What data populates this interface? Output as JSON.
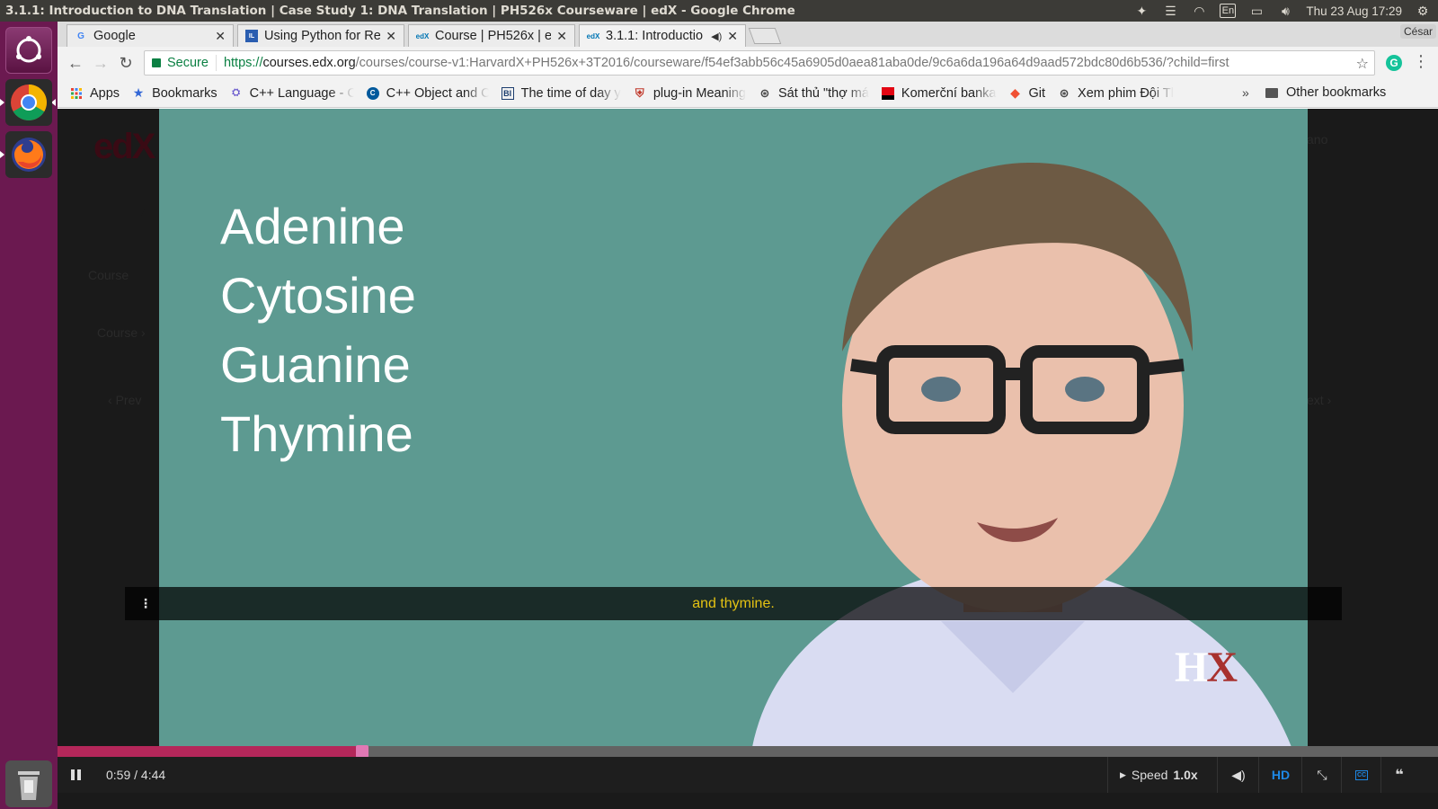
{
  "os": {
    "window_title": "3.1.1: Introduction to DNA Translation | Case Study 1: DNA Translation | PH526x Courseware | edX - Google Chrome",
    "keyboard": "En",
    "datetime": "Thu 23 Aug 17:29"
  },
  "launcher": {
    "items": [
      "Ubuntu",
      "Google Chrome",
      "Firefox",
      "Trash"
    ]
  },
  "tabs": [
    {
      "label": "Google",
      "favicon": "G"
    },
    {
      "label": "Using Python for Re",
      "favicon": "IL"
    },
    {
      "label": "Course | PH526x | ec",
      "favicon": "edX"
    },
    {
      "label": "3.1.1: Introductio",
      "favicon": "edX"
    }
  ],
  "profile": "César",
  "omnibox": {
    "secure_label": "Secure",
    "url_scheme": "https://",
    "url_host": "courses.edx.org",
    "url_path": "/courses/course-v1:HarvardX+PH526x+3T2016/courseware/f54ef3abb56c45a6905d0aea81aba0de/9c6a6da196a64d9aad572bdc80d6b536/?child=first"
  },
  "bookmarks": [
    {
      "label": "Apps",
      "icon": "apps-grid"
    },
    {
      "label": "Bookmarks",
      "icon": "star"
    },
    {
      "label": "C++ Language - C",
      "icon": "cpp"
    },
    {
      "label": "C++ Object and C",
      "icon": "cpp-object"
    },
    {
      "label": "The time of day y",
      "icon": "bl"
    },
    {
      "label": "plug-in Meaning",
      "icon": "shield"
    },
    {
      "label": "Sát thủ \"thợ má",
      "icon": "globe"
    },
    {
      "label": "Komerční banka",
      "icon": "kb"
    },
    {
      "label": "Git",
      "icon": "git"
    },
    {
      "label": "Xem phim Đội Tl",
      "icon": "globe"
    }
  ],
  "bookmarks_more": "»",
  "other_bookmarks": "Other bookmarks",
  "page": {
    "bg_text_course": "Course",
    "bg_text_breadcrumb": "Course ›",
    "bg_text_prev": "Prev",
    "bg_text_next": "ext",
    "bg_text_user": "ano"
  },
  "video": {
    "slide_terms": [
      "Adenine",
      "Cytosine",
      "Guanine",
      "Thymine"
    ],
    "logo_h": "H",
    "logo_x": "X",
    "caption": "and thymine.",
    "progress_fraction": 0.2172,
    "time_display": "0:59 / 4:44",
    "speed_label": "Speed",
    "speed_value": "1.0x",
    "hd_label": "HD"
  },
  "colors": {
    "slide_bg": "#5d9a91",
    "caption_text": "#e4c213",
    "progress_fill": "#b4275a",
    "launcher_bg": "#6b1950"
  }
}
